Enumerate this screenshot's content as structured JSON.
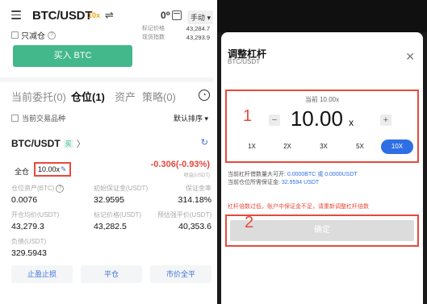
{
  "left": {
    "header": {
      "pair": "BTC/USDT",
      "leverage_tag": "10x",
      "swap_glyph": "⇌",
      "kline_glyph": "0⁰",
      "mode": "手动 ▾"
    },
    "reduce_only": {
      "label": "只减仓"
    },
    "price_panel": {
      "rows": [
        {
          "label": "标记价格",
          "value": "43,284.7"
        },
        {
          "label": "现货指数",
          "value": "43,293.9"
        }
      ]
    },
    "buy_button": "买入 BTC",
    "tabs": [
      {
        "label": "当前委托(0)",
        "active": false
      },
      {
        "label": "仓位(1)",
        "active": true
      },
      {
        "label": "资产",
        "active": false
      },
      {
        "label": "策略(0)",
        "active": false
      }
    ],
    "filter": {
      "current_only": "当前交易品种",
      "sort": "默认排序 ▾"
    },
    "position": {
      "pair": "BTC/USDT",
      "side_badge": "买",
      "chevron": "〉",
      "margin_mode": "全仓",
      "leverage": "10.00x",
      "edit_icon": "✎",
      "pnl": "-0.306(-0.93%)",
      "pnl_label": "收益(USDT)",
      "rows": [
        {
          "cells": [
            {
              "label": "仓位资产(BTC)",
              "value": "0.0076",
              "help": true
            },
            {
              "label": "初始保证金(USDT)",
              "value": "32.9595"
            },
            {
              "label": "保证金率",
              "value": "314.18%"
            }
          ]
        },
        {
          "cells": [
            {
              "label": "开仓均价(USDT)",
              "value": "43,279.3"
            },
            {
              "label": "标记价格(USDT)",
              "value": "43,282.5"
            },
            {
              "label": "预估强平价(USDT)",
              "value": "40,353.6"
            }
          ]
        },
        {
          "cells": [
            {
              "label": "负债(USDT)",
              "value": "329.5943"
            }
          ]
        }
      ]
    },
    "actions": [
      "止盈止损",
      "平仓",
      "市价全平"
    ]
  },
  "right": {
    "modal": {
      "title": "调整杠杆",
      "subtitle": "BTC/USDT",
      "close": "✕",
      "annotation_1": "1",
      "current_label": "当前 10.00x",
      "leverage_value": "10.00",
      "leverage_unit": "x",
      "minus": "−",
      "plus": "+",
      "presets": [
        "1X",
        "2X",
        "3X",
        "5X",
        "10X"
      ],
      "selected_preset": "10X",
      "info_line1_prefix": "当前杠杆借数量大可开: ",
      "info_line1_value": "0.0000BTC 或 0.0000USDT",
      "info_line2_prefix": "当前仓位所需保证金: ",
      "info_line2_value": "32.9594 USDT",
      "warning": "杠杆倍数过低，账户中保证金不足，请重新调整杠杆倍数",
      "annotation_2": "2",
      "confirm_label": "确定"
    }
  },
  "colors": {
    "buy_green": "#43b88a",
    "loss_red": "#e4473e",
    "annotation_red": "#e74a3b",
    "link_blue": "#3a6fd8",
    "preset_blue": "#2f6fe4",
    "disabled_gray": "#dcdcdc"
  }
}
